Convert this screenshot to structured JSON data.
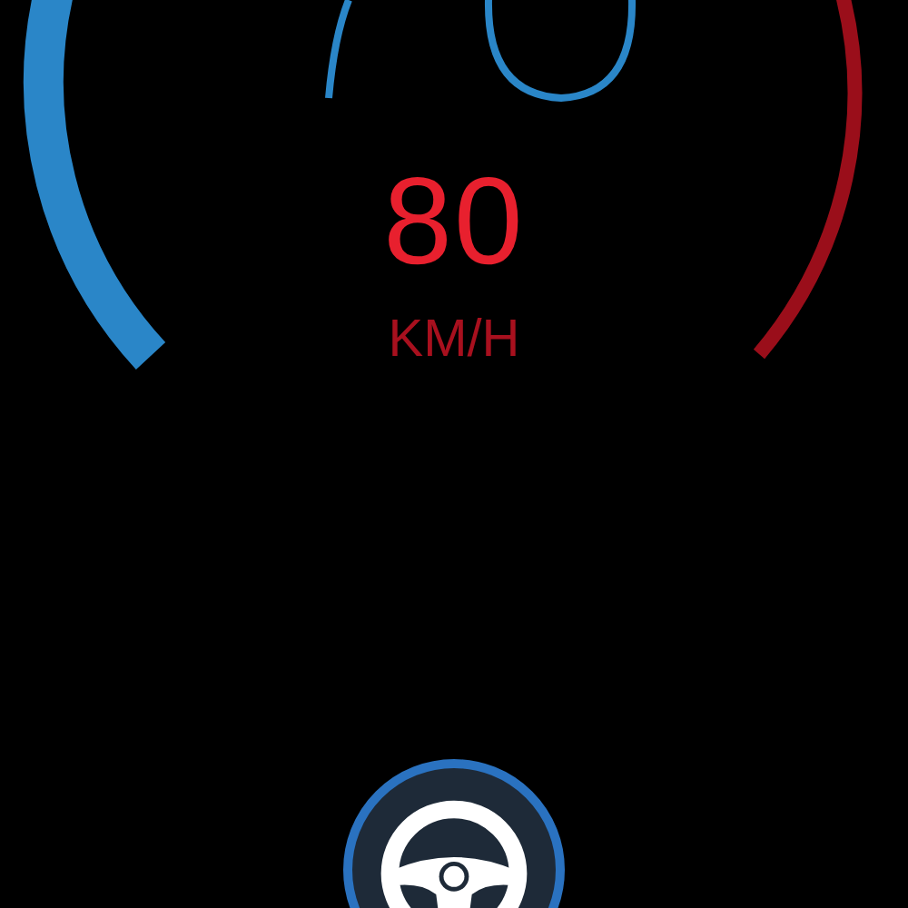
{
  "gauge": {
    "speed": "80",
    "unit": "KM/H"
  },
  "drive_button": {
    "kind": "steering"
  }
}
